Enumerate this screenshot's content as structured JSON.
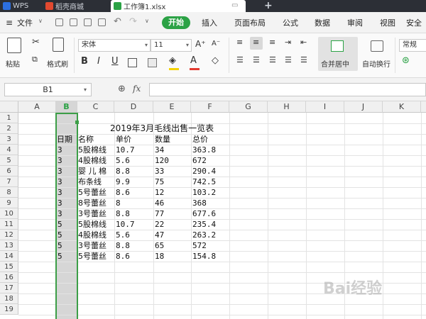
{
  "tabbar": {
    "tabs": [
      {
        "label": "WPS",
        "color": "#2c6fe0"
      },
      {
        "label": "稻壳商城",
        "color": "#e2492f"
      },
      {
        "label": "工作簿1.xlsx",
        "color": "#2ba245"
      }
    ],
    "new_tab": "+"
  },
  "menu": {
    "file": "文件",
    "start": "开始",
    "items": [
      "插入",
      "页面布局",
      "公式",
      "数据",
      "审阅",
      "视图",
      "安全"
    ]
  },
  "ribbon": {
    "paste": "粘贴",
    "format_painter": "格式刷",
    "font_name": "宋体",
    "font_size": "11",
    "merge_center": "合并居中",
    "auto_wrap": "自动换行",
    "number_format": "常规"
  },
  "formula_bar": {
    "name_box": "B1",
    "fx": "fx",
    "formula": ""
  },
  "grid": {
    "columns": [
      "A",
      "B",
      "C",
      "D",
      "E",
      "F",
      "G",
      "H",
      "I",
      "J",
      "K"
    ],
    "rows": [
      "1",
      "2",
      "3",
      "4",
      "5",
      "6",
      "7",
      "8",
      "9",
      "10",
      "11",
      "12",
      "13",
      "14",
      "15",
      "16",
      "17",
      "18",
      "19"
    ],
    "selected_column": "B",
    "title": "2019年3月毛线出售一览表",
    "headers": [
      "日期",
      "名称",
      "单价",
      "数量",
      "总价"
    ],
    "records": [
      [
        "3",
        "5股棉线",
        "10.7",
        "34",
        "363.8"
      ],
      [
        "3",
        "4股棉线",
        "5.6",
        "120",
        "672"
      ],
      [
        "3",
        "婴 儿 棉",
        "8.8",
        "33",
        "290.4"
      ],
      [
        "3",
        "布条线",
        "9.9",
        "75",
        "742.5"
      ],
      [
        "3",
        "5号蕾丝",
        "8.6",
        "12",
        "103.2"
      ],
      [
        "3",
        "8号蕾丝",
        "8",
        "46",
        "368"
      ],
      [
        "3",
        "3号蕾丝",
        "8.8",
        "77",
        "677.6"
      ],
      [
        "5",
        "5股棉线",
        "10.7",
        "22",
        "235.4"
      ],
      [
        "5",
        "4股棉线",
        "5.6",
        "47",
        "263.2"
      ],
      [
        "5",
        "3号蕾丝",
        "8.8",
        "65",
        "572"
      ],
      [
        "5",
        "5号蕾丝",
        "8.6",
        "18",
        "154.8"
      ]
    ]
  },
  "colors": {
    "accent_green": "#2ba245",
    "selection_border": "#3c9e47",
    "selection_fill": "#d6d6d6"
  },
  "watermark": "Bai经验"
}
